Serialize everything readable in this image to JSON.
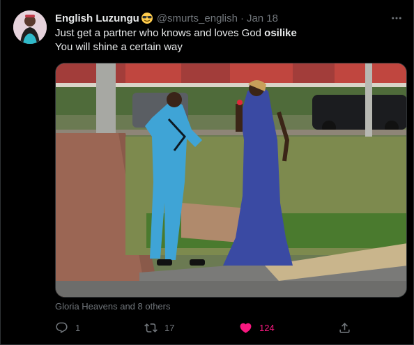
{
  "tweet": {
    "author": {
      "display_name": "English Luzungu",
      "emoji_icon": "smiling-face-with-sunglasses-emoji",
      "handle": "@smurts_english",
      "separator": "·",
      "date": "Jan 18"
    },
    "text_line1_prefix": "Just get a partner who knows and loves God ",
    "text_line1_bold": "osilike",
    "text_line2": "You will shine a certain way",
    "media_alt": "Photo",
    "tagged_people": "Gloria Heavens and 8 others",
    "actions": {
      "reply_count": "1",
      "retweet_count": "17",
      "like_count": "124",
      "like_active": true,
      "like_color": "#f91880"
    }
  },
  "colors": {
    "background": "#000000",
    "text_primary": "#e7e9ea",
    "text_secondary": "#71767b",
    "border": "#2f3336"
  },
  "icons": {
    "more": "more-horizontal-icon",
    "reply": "reply-bubble-icon",
    "retweet": "retweet-icon",
    "like": "heart-filled-icon",
    "share": "share-upload-icon"
  }
}
